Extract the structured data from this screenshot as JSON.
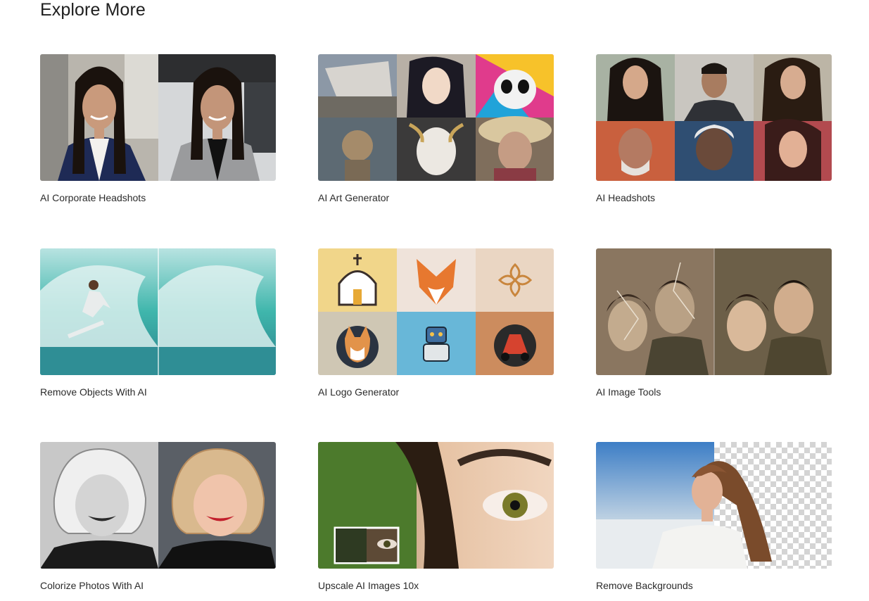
{
  "page": {
    "title": "Explore More"
  },
  "cards": [
    {
      "label": "AI Corporate Headshots"
    },
    {
      "label": "AI Art Generator"
    },
    {
      "label": "AI Headshots"
    },
    {
      "label": "Remove Objects With AI"
    },
    {
      "label": "AI Logo Generator"
    },
    {
      "label": "AI Image Tools"
    },
    {
      "label": "Colorize Photos With AI"
    },
    {
      "label": "Upscale AI Images 10x"
    },
    {
      "label": "Remove Backgrounds"
    }
  ]
}
